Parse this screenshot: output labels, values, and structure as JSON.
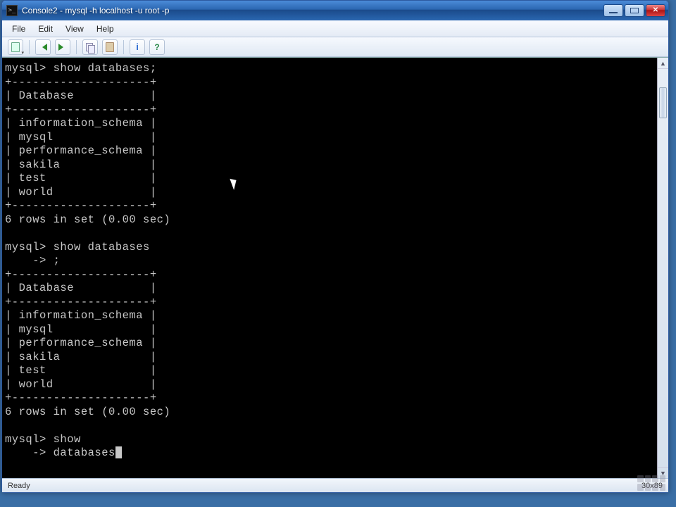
{
  "window": {
    "title": "Console2 - mysql  -h localhost -u root -p"
  },
  "menu": {
    "file": "File",
    "edit": "Edit",
    "view": "View",
    "help": "Help"
  },
  "terminal": {
    "line_prompt1": "mysql> show databases;",
    "border": "+--------------------+",
    "header_db": "| Database           |",
    "row_info": "| information_schema |",
    "row_mysql": "| mysql              |",
    "row_perf": "| performance_schema |",
    "row_sakila": "| sakila             |",
    "row_test": "| test               |",
    "row_world": "| world              |",
    "rows_msg": "6 rows in set (0.00 sec)",
    "blank": "",
    "line_prompt2": "mysql> show databases",
    "cont_semi": "    -> ;",
    "line_prompt3": "mysql> show",
    "cont_db": "    -> databases"
  },
  "status": {
    "left": "Ready",
    "right": "30x89"
  }
}
